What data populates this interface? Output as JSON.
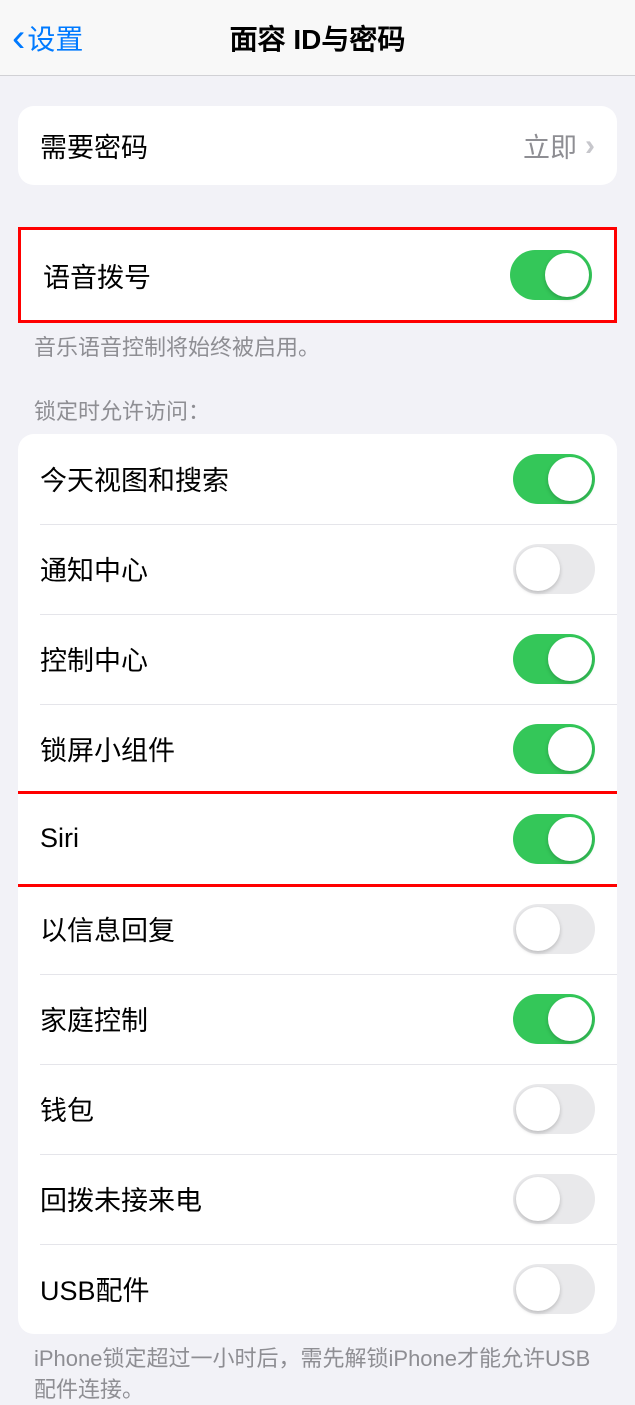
{
  "nav": {
    "back_label": "设置",
    "title": "面容 ID与密码"
  },
  "passcode_section": {
    "label": "需要密码",
    "value": "立即"
  },
  "voice_section": {
    "label": "语音拨号",
    "on": true,
    "footer": "音乐语音控制将始终被启用。"
  },
  "access_section": {
    "header": "锁定时允许访问：",
    "items": [
      {
        "label": "今天视图和搜索",
        "on": true
      },
      {
        "label": "通知中心",
        "on": false
      },
      {
        "label": "控制中心",
        "on": true
      },
      {
        "label": "锁屏小组件",
        "on": true
      },
      {
        "label": "Siri",
        "on": true
      },
      {
        "label": "以信息回复",
        "on": false
      },
      {
        "label": "家庭控制",
        "on": true
      },
      {
        "label": "钱包",
        "on": false
      },
      {
        "label": "回拨未接来电",
        "on": false
      },
      {
        "label": "USB配件",
        "on": false
      }
    ],
    "footer": "iPhone锁定超过一小时后，需先解锁iPhone才能允许USB 配件连接。"
  }
}
